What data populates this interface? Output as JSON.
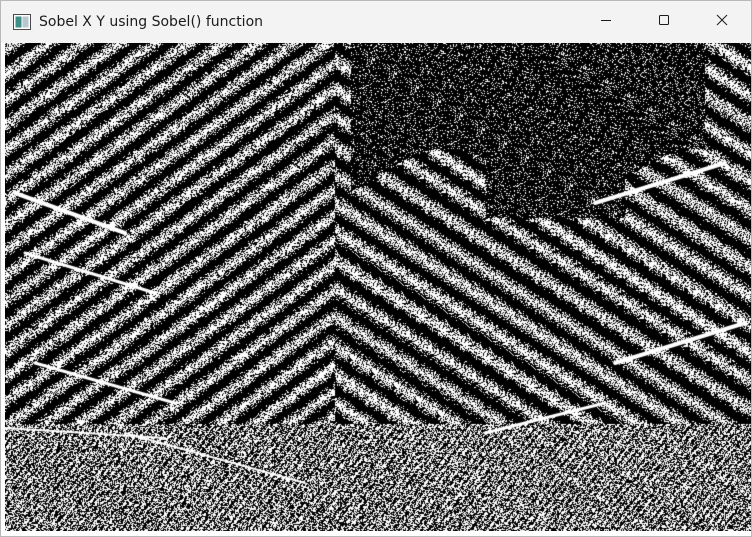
{
  "window": {
    "title": "Sobel X Y using Sobel() function"
  },
  "icons": {
    "app": "opencv-window-icon",
    "minimize": "minimize-icon",
    "maximize": "maximize-icon",
    "close": "close-icon"
  },
  "image": {
    "description_kind": "sobel-edge-map",
    "colors": {
      "background": "#000000",
      "edge": "#ffffff"
    }
  }
}
